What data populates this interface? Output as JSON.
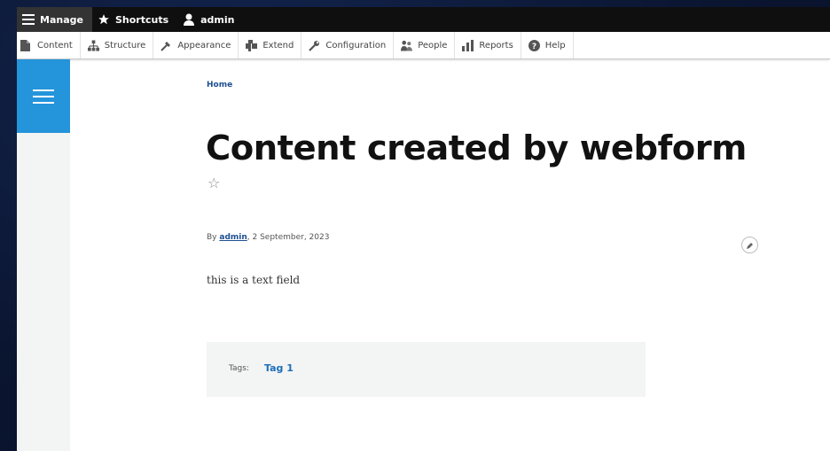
{
  "toolbar": {
    "manage_label": "Manage",
    "shortcuts_label": "Shortcuts",
    "user_label": "admin"
  },
  "tray": {
    "items": [
      {
        "label": "Content",
        "icon": "content-icon"
      },
      {
        "label": "Structure",
        "icon": "structure-icon"
      },
      {
        "label": "Appearance",
        "icon": "appearance-icon"
      },
      {
        "label": "Extend",
        "icon": "extend-icon"
      },
      {
        "label": "Configuration",
        "icon": "configuration-icon"
      },
      {
        "label": "People",
        "icon": "people-icon"
      },
      {
        "label": "Reports",
        "icon": "reports-icon"
      },
      {
        "label": "Help",
        "icon": "help-icon"
      }
    ]
  },
  "breadcrumb": {
    "home": "Home"
  },
  "node": {
    "title": "Content created by webform",
    "by_prefix": "By ",
    "author": "admin",
    "date": ", 2 September, 2023",
    "body": "this is a text field",
    "tags_label": "Tags:",
    "tags": [
      "Tag 1"
    ]
  },
  "colors": {
    "accent": "#2494db",
    "link": "#1d4f91",
    "toolbar_bg": "#0f0f0f"
  }
}
